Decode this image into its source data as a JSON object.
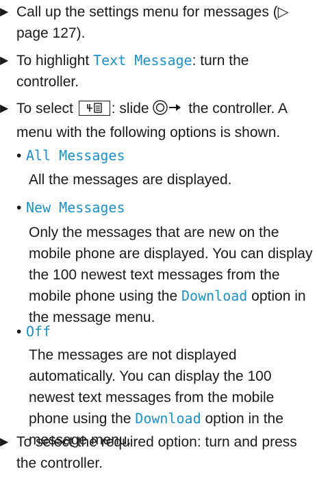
{
  "steps": [
    {
      "text": "Call up the settings menu for messages (▷ page 127)."
    },
    {
      "pre": "To highlight ",
      "ui": "Text Message",
      "post": ": turn the controller."
    },
    {
      "pre": "To select ",
      "mid": ": slide ",
      "post": " the controller. A menu with the following options is shown."
    },
    {
      "text": "To select the required option: turn and press the controller."
    }
  ],
  "options": [
    {
      "label": "All Messages",
      "desc": "All the messages are displayed."
    },
    {
      "label": "New Messages",
      "desc_pre": "Only the messages that are new on the mobile phone are displayed. You can display the 100 newest text messages from the mobile phone using the ",
      "desc_ui": "Download",
      "desc_post": " option in the message menu."
    },
    {
      "label": "Off",
      "desc_pre": "The messages are not displayed automatically. You can display the 100 newest text messages from the mobile phone using the ",
      "desc_ui": "Download",
      "desc_post": " option in the message menu."
    }
  ],
  "icons": {
    "step_marker": "triangle-right-icon",
    "menu_key": "menu-list-icon",
    "controller": "controller-slide-right-icon"
  },
  "colors": {
    "ui_text": "#1f8fc4",
    "body_text": "#1a1a1a"
  }
}
